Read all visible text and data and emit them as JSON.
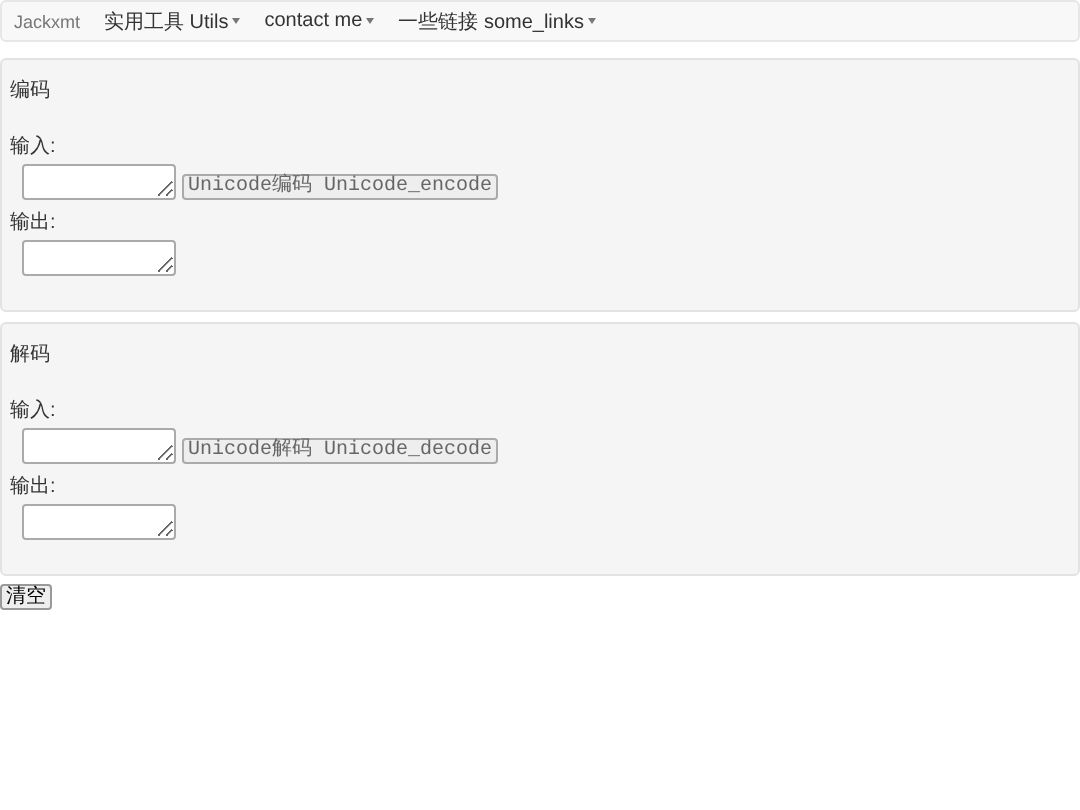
{
  "navbar": {
    "brand": "Jackxmt",
    "menus": [
      {
        "label": "实用工具 Utils"
      },
      {
        "label": "contact me"
      },
      {
        "label": "一些链接 some_links"
      }
    ]
  },
  "panels": [
    {
      "title": "编码",
      "input_label": "输入:",
      "button": "Unicode编码 Unicode_encode",
      "output_label": "输出:"
    },
    {
      "title": "解码",
      "input_label": "输入:",
      "button": "Unicode解码 Unicode_decode",
      "output_label": "输出:"
    }
  ],
  "clear_button": "清空"
}
